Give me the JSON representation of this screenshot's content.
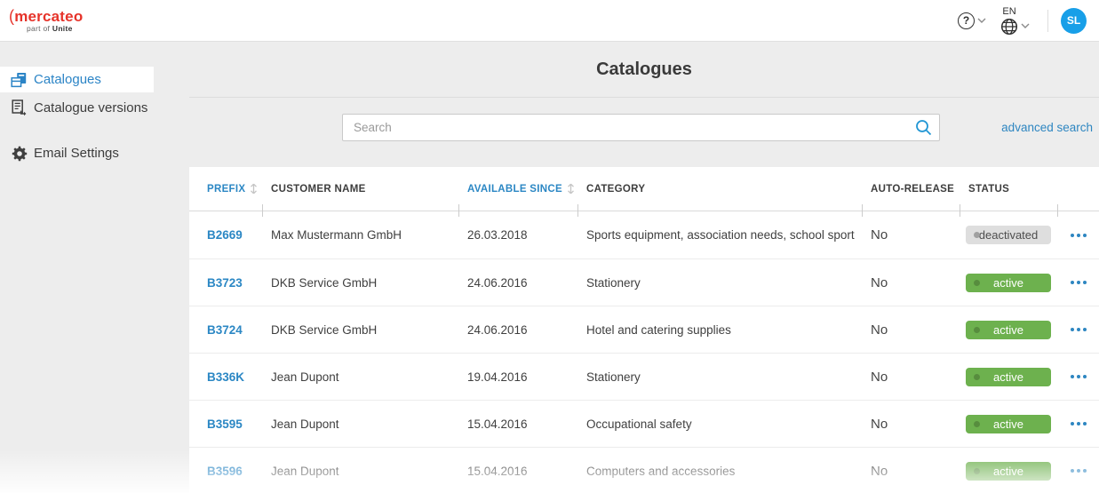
{
  "brand": {
    "name": "mercateo",
    "paren": "(",
    "tagline_prefix": "part of",
    "tagline_brand": "Unite"
  },
  "topbar": {
    "help_symbol": "?",
    "language": "EN",
    "avatar_initials": "SL",
    "icons": {
      "help": "question-circle-icon",
      "language": "globe-icon",
      "expand": "chevron-down-icon"
    }
  },
  "sidebar": {
    "groups": [
      [
        {
          "id": "catalogues",
          "label": "Catalogues",
          "icon": "catalog",
          "active": true
        },
        {
          "id": "catalogue-versions",
          "label": "Catalogue versions",
          "icon": "versions",
          "active": false
        }
      ],
      [
        {
          "id": "email-settings",
          "label": "Email Settings",
          "icon": "gear",
          "active": false
        }
      ]
    ]
  },
  "main": {
    "title": "Catalogues",
    "search_placeholder": "Search",
    "search_icon": "magnifier-icon",
    "advanced_search_label": "advanced search",
    "table": {
      "columns": [
        {
          "label": "PREFIX",
          "sortable": true
        },
        {
          "label": "CUSTOMER NAME",
          "sortable": false
        },
        {
          "label": "AVAILABLE SINCE",
          "sortable": true
        },
        {
          "label": "CATEGORY",
          "sortable": false
        },
        {
          "label": "AUTO-RELEASE",
          "sortable": false
        },
        {
          "label": "STATUS",
          "sortable": false
        }
      ],
      "row_actions_icon": "three-dots-icon",
      "rows": [
        {
          "prefix": "B2669",
          "customer_name": "Max Mustermann GmbH",
          "available_since": "26.03.2018",
          "category": "Sports equipment, association needs, school sport",
          "auto_release": "No",
          "status": "deactivated"
        },
        {
          "prefix": "B3723",
          "customer_name": "DKB Service GmbH",
          "available_since": "24.06.2016",
          "category": "Stationery",
          "auto_release": "No",
          "status": "active"
        },
        {
          "prefix": "B3724",
          "customer_name": "DKB Service GmbH",
          "available_since": "24.06.2016",
          "category": "Hotel and catering supplies",
          "auto_release": "No",
          "status": "active"
        },
        {
          "prefix": "B336K",
          "customer_name": "Jean Dupont",
          "available_since": "19.04.2016",
          "category": "Stationery",
          "auto_release": "No",
          "status": "active"
        },
        {
          "prefix": "B3595",
          "customer_name": "Jean Dupont",
          "available_since": "15.04.2016",
          "category": "Occupational safety",
          "auto_release": "No",
          "status": "active"
        },
        {
          "prefix": "B3596",
          "customer_name": "Jean Dupont",
          "available_since": "15.04.2016",
          "category": "Computers and accessories",
          "auto_release": "No",
          "status": "active"
        }
      ]
    }
  },
  "colors": {
    "brand_red": "#e6332a",
    "accent_blue": "#2b87c4",
    "avatar_blue": "#189fe8",
    "active_green": "#6db14e",
    "deactivated_gray": "#dedede",
    "page_background": "#ededed"
  }
}
